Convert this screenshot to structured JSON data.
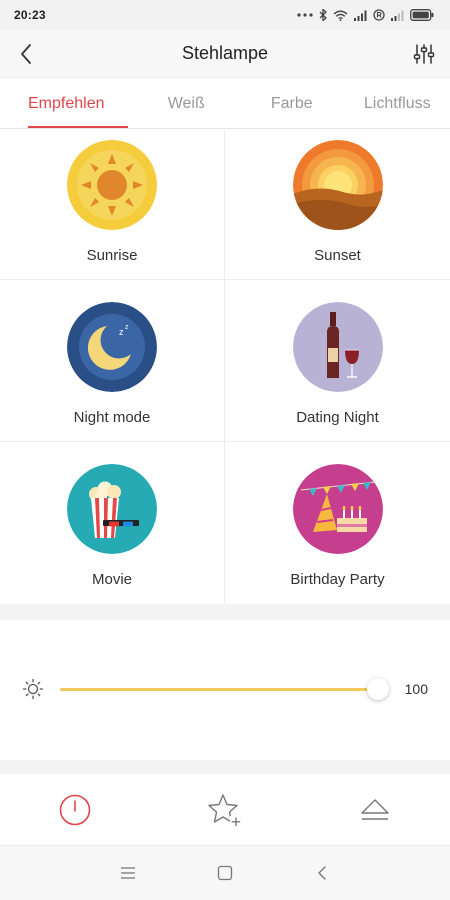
{
  "status_bar": {
    "time": "20:23",
    "icons": [
      "dots-icon",
      "bluetooth-icon",
      "wifi-icon",
      "signal-icon",
      "registered-icon",
      "signal-low-icon",
      "battery-icon"
    ]
  },
  "header": {
    "title": "Stehlampe",
    "back_icon": "back-arrow-icon",
    "settings_icon": "sliders-icon"
  },
  "tabs": [
    {
      "label": "Empfehlen",
      "active": true
    },
    {
      "label": "Weiß",
      "active": false
    },
    {
      "label": "Farbe",
      "active": false
    },
    {
      "label": "Lichtfluss",
      "active": false
    }
  ],
  "scenes": [
    {
      "label": "Sunrise",
      "icon": "sunrise-icon"
    },
    {
      "label": "Sunset",
      "icon": "sunset-icon"
    },
    {
      "label": "Night mode",
      "icon": "night-mode-icon"
    },
    {
      "label": "Dating Night",
      "icon": "wine-icon"
    },
    {
      "label": "Movie",
      "icon": "popcorn-icon"
    },
    {
      "label": "Birthday Party",
      "icon": "party-icon"
    }
  ],
  "brightness": {
    "value": "100",
    "level_percent": 100,
    "accent": "#f2c85b"
  },
  "actions": [
    {
      "icon": "power-icon",
      "color": "#e0474c"
    },
    {
      "icon": "star-add-icon",
      "color": "#777777"
    },
    {
      "icon": "eject-icon",
      "color": "#777777"
    }
  ],
  "navbar": [
    "menu-icon",
    "home-icon",
    "back-nav-icon"
  ],
  "colors": {
    "accent": "#e0474c",
    "tab_inactive": "#999999"
  }
}
